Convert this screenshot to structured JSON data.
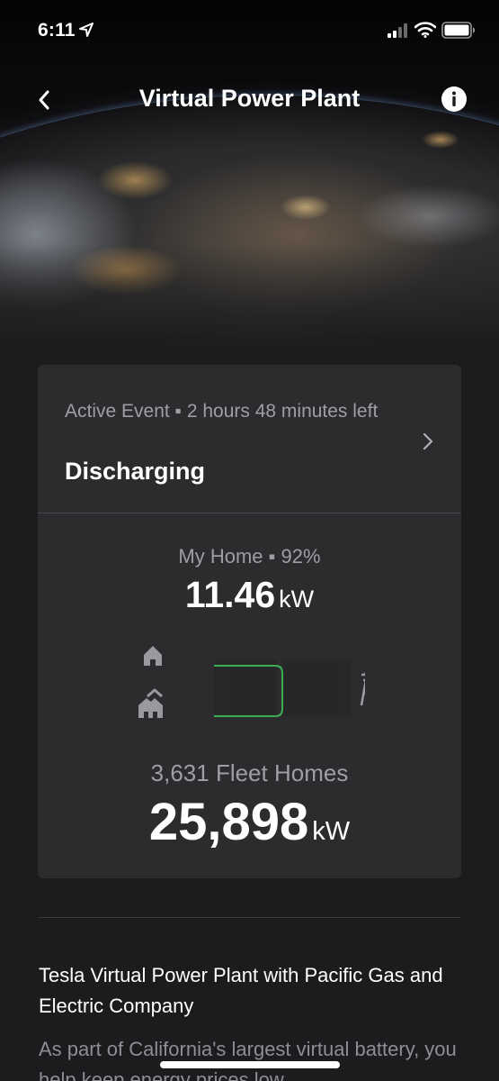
{
  "status_bar": {
    "time": "6:11"
  },
  "nav": {
    "title": "Virtual Power Plant"
  },
  "event": {
    "subtitle": "Active Event ▪ 2 hours 48 minutes left",
    "status": "Discharging"
  },
  "my_home": {
    "label": "My Home ▪ 92%",
    "power_value": "11.46",
    "power_unit": "kW"
  },
  "fleet": {
    "label": "3,631 Fleet Homes",
    "power_value": "25,898",
    "power_unit": "kW"
  },
  "about": {
    "title": "Tesla Virtual Power Plant with Pacific Gas and Electric Company",
    "text": "As part of California's largest virtual battery, you help keep energy prices low"
  },
  "colors": {
    "background": "#1c1c1e",
    "card": "#2c2c2e",
    "flow_active": "#3ec45a",
    "secondary_text": "#9e9ea3"
  },
  "icons": [
    "location-arrow-icon",
    "signal-icon",
    "wifi-icon",
    "battery-icon",
    "back-chevron-icon",
    "info-icon",
    "chevron-right-icon",
    "home-icon",
    "fleet-homes-icon",
    "power-grid-tower-icon"
  ]
}
